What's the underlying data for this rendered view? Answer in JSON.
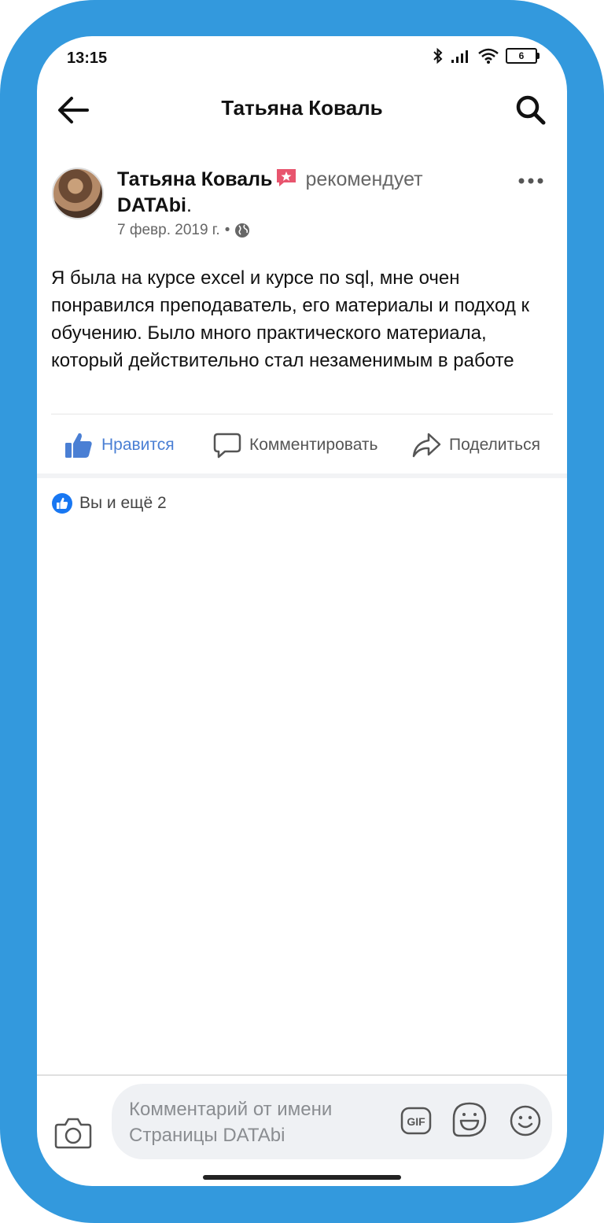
{
  "status_bar": {
    "time": "13:15",
    "battery": "6",
    "icons": [
      "bluetooth-icon",
      "signal-icon",
      "wifi-icon",
      "battery-icon"
    ]
  },
  "header": {
    "title": "Татьяна Коваль"
  },
  "post": {
    "author": "Татьяна Коваль",
    "action": "рекомендует",
    "page": "DATAbi",
    "page_suffix": ".",
    "date": "7 февр. 2019 г.",
    "separator": "•",
    "text": "Я была на курсе excel и курсе по sql, мне очен понравился преподаватель, его материалы и подход к обучению. Было много практического материала, который действительно стал незаменимым в работе"
  },
  "actions": {
    "like": "Нравится",
    "comment": "Комментировать",
    "share": "Поделиться"
  },
  "reactions": {
    "summary": "Вы и ещё 2"
  },
  "composer": {
    "placeholder": "Комментарий от имени Страницы DATAbi",
    "gif": "GIF"
  },
  "colors": {
    "frame": "#3399dd",
    "accent": "#4a7fd4",
    "like_badge": "#1877f2",
    "recommend_badge": "#e8556e"
  }
}
